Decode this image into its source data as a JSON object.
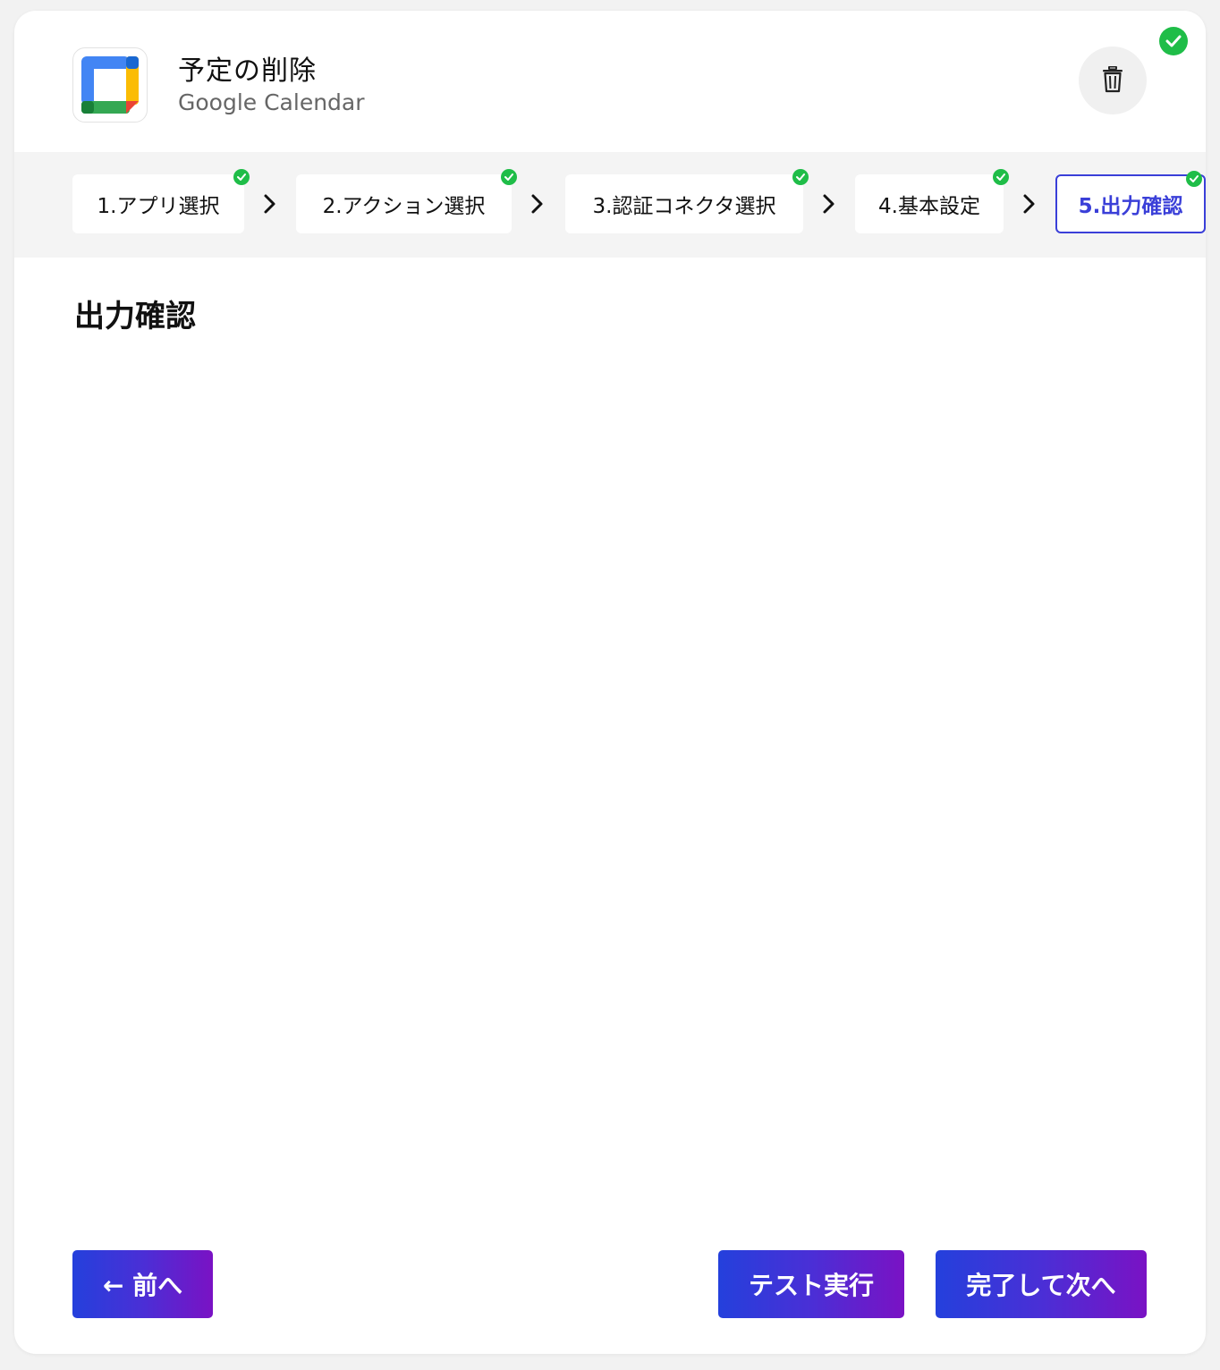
{
  "header": {
    "title": "予定の削除",
    "subtitle": "Google Calendar"
  },
  "steps": [
    {
      "label": "1.アプリ選択",
      "completed": true,
      "active": false
    },
    {
      "label": "2.アクション選択",
      "completed": true,
      "active": false
    },
    {
      "label": "3.認証コネクタ選択",
      "completed": true,
      "active": false
    },
    {
      "label": "4.基本設定",
      "completed": true,
      "active": false
    },
    {
      "label": "5.出力確認",
      "completed": true,
      "active": true
    }
  ],
  "section": {
    "title": "出力確認"
  },
  "footer": {
    "back_label": "← 前へ",
    "test_label": "テスト実行",
    "next_label": "完了して次へ"
  },
  "colors": {
    "accent": "#3a3fd8",
    "success": "#1fbd48",
    "gradient_start": "#2440dc",
    "gradient_end": "#7a12c4"
  },
  "icons": {
    "app": "google-calendar-icon",
    "trash": "trash-icon",
    "status": "check-circle-icon",
    "separator": "chevron-right-icon"
  }
}
